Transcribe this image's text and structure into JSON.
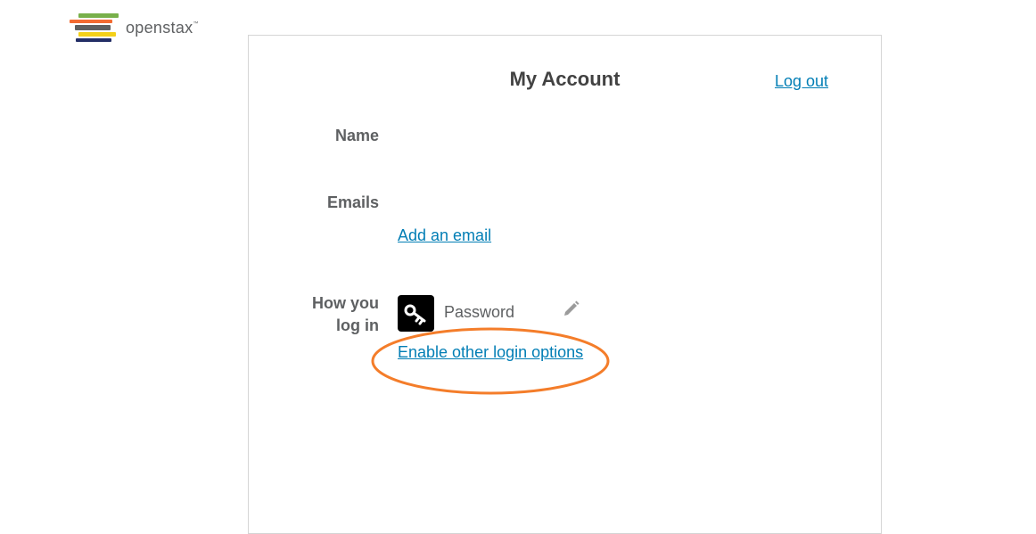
{
  "brand": {
    "logo_text": "openstax",
    "tm": "™"
  },
  "page": {
    "title": "My Account",
    "logout_label": "Log out"
  },
  "profile": {
    "name_label": "Name",
    "emails_label": "Emails",
    "add_email_label": "Add an email",
    "login_label_line1": "How you",
    "login_label_line2": "log in",
    "login_method": "Password",
    "enable_options_label": "Enable other login options"
  },
  "colors": {
    "link": "#027eb5",
    "annotation": "#f47d2a",
    "logo_bars": [
      "#78b04a",
      "#f36b32",
      "#5e6062",
      "#f4d019",
      "#232e66"
    ]
  },
  "icons": {
    "login_method": "key-icon",
    "edit": "pencil-icon"
  }
}
